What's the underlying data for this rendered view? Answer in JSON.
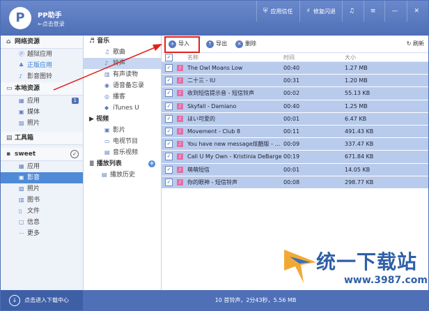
{
  "titlebar": {
    "app_name": "PP助手",
    "login": "←点击登录",
    "buttons": [
      {
        "icon": "shield-icon",
        "label": "应用信任"
      },
      {
        "icon": "lightning-icon",
        "label": "修复闪退"
      },
      {
        "icon": "music-icon",
        "label": ""
      },
      {
        "icon": "menu-icon",
        "label": ""
      },
      {
        "icon": "minimize-icon",
        "label": ""
      },
      {
        "icon": "close-icon",
        "label": ""
      }
    ]
  },
  "nav": {
    "network": "网络资源",
    "network_items": [
      "越狱应用",
      "正版应用",
      "影音图铃"
    ],
    "local": "本地资源",
    "local_items": [
      "应用",
      "媒体",
      "照片"
    ],
    "local_badge": "1",
    "toolbox": "工具箱",
    "device": "sweet",
    "device_items": [
      "应用",
      "影音",
      "照片",
      "图书",
      "文件",
      "信息",
      "更多"
    ]
  },
  "subnav": {
    "music": "音乐",
    "music_items": [
      "歌曲",
      "铃声",
      "有声读物",
      "语音备忘录",
      "播客",
      "iTunes U"
    ],
    "video": "视频",
    "video_items": [
      "影片",
      "电视节目",
      "音乐视频"
    ],
    "playlist": "播放列表",
    "playlist_items": [
      "播放历史"
    ]
  },
  "toolbar": {
    "import": "导入",
    "export": "导出",
    "delete": "删除",
    "refresh": "刷新"
  },
  "table": {
    "col_name": "名称",
    "col_time": "时间",
    "col_size": "大小",
    "rows": [
      {
        "name": "The Owl Moans Low",
        "time": "00:40",
        "size": "1.27 MB"
      },
      {
        "name": "二十三 - IU",
        "time": "00:31",
        "size": "1.20 MB"
      },
      {
        "name": "收到短信提示音 - 短信铃声",
        "time": "00:02",
        "size": "55.13 KB"
      },
      {
        "name": "Skyfall - Damiano",
        "time": "00:40",
        "size": "1.25 MB"
      },
      {
        "name": "ほい可爱的",
        "time": "00:01",
        "size": "6.47 KB"
      },
      {
        "name": "Movement - Club 8",
        "time": "00:11",
        "size": "491.43 KB"
      },
      {
        "name": "You have new message炫酷版 - 短信铃...",
        "time": "00:09",
        "size": "337.47 KB"
      },
      {
        "name": "Call U My Own - Kristinia DeBarge",
        "time": "00:19",
        "size": "671.84 KB"
      },
      {
        "name": "萌萌短信",
        "time": "00:01",
        "size": "14.05 KB"
      },
      {
        "name": "你的眼神 - 短信铃声",
        "time": "00:08",
        "size": "298.77 KB"
      }
    ]
  },
  "status": {
    "download": "点击进入下载中心",
    "summary": "10 首铃声，2分43秒，5.56 MB"
  },
  "watermark": {
    "text": "统一下载站",
    "url": "www.3987.com"
  },
  "colors": {
    "titlebar": "#5a7bc1",
    "selected_row": "#b8cbec",
    "highlight_box": "#e0221c",
    "annotation_arrow": "#e0221c"
  }
}
